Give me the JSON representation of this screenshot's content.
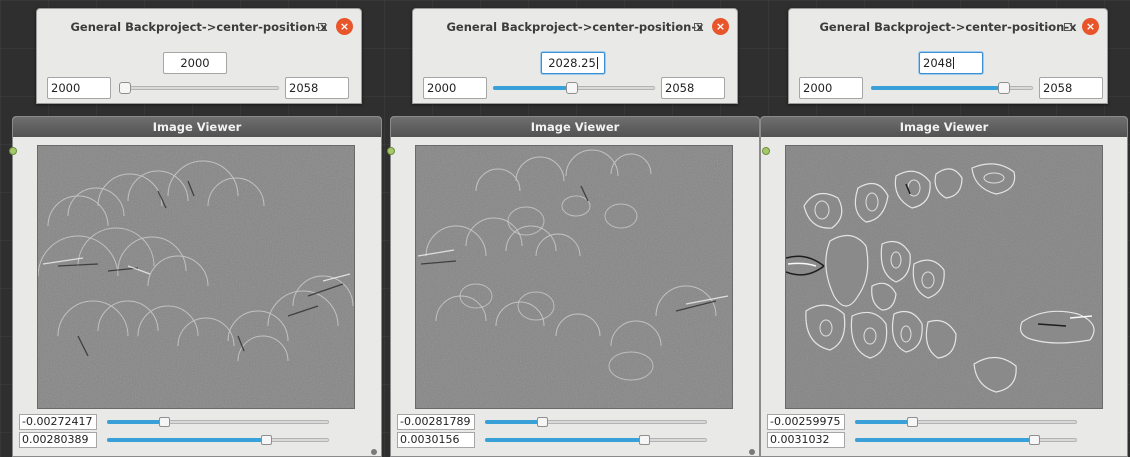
{
  "windows": [
    {
      "title": "General Backproject->center-position-x",
      "value": "2000",
      "min": "2000",
      "max": "2058",
      "slider_fraction": 0.0,
      "viewer": {
        "title": "Image Viewer",
        "low": "-0.00272417",
        "high": "0.00280389",
        "low_fraction": 0.26,
        "high_fraction": 0.72
      }
    },
    {
      "title": "General Backproject->center-position-x",
      "value": "2028.25",
      "min": "2000",
      "max": "2058",
      "slider_fraction": 0.49,
      "viewer": {
        "title": "Image Viewer",
        "low": "-0.00281789",
        "high": "0.0030156",
        "low_fraction": 0.26,
        "high_fraction": 0.72
      }
    },
    {
      "title": "General Backproject->center-position-x",
      "value": "2048",
      "min": "2000",
      "max": "2058",
      "slider_fraction": 0.82,
      "viewer": {
        "title": "Image Viewer",
        "low": "-0.00259975",
        "high": "0.0031032",
        "low_fraction": 0.26,
        "high_fraction": 0.81
      }
    }
  ],
  "colors": {
    "accent": "#3aa0d8",
    "close_button": "#e9552b",
    "port": "#a6c86b"
  },
  "icons": {
    "minimize": "minimize-icon",
    "maximize": "maximize-icon",
    "close": "close-icon"
  }
}
